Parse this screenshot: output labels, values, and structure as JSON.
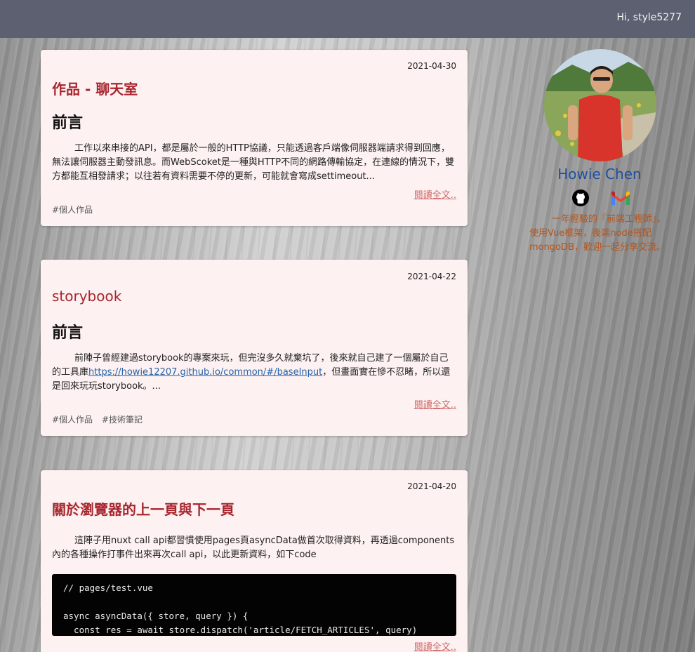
{
  "header": {
    "greeting": "Hi, style5277"
  },
  "posts": [
    {
      "date": "2021-04-30",
      "title": "作品 - 聊天室",
      "heading": "前言",
      "excerpt": "工作以來串接的API，都是屬於一般的HTTP協議，只能透過客戶端像伺服器端請求得到回應，無法讓伺服器主動發訊息。而WebScoket是一種與HTTP不同的網路傳輸協定，在連線的情況下，雙方都能互相發請求；以往若有資料需要不停的更新，可能就會寫成settimeout...",
      "read_more": "閱讀全文..",
      "tags": [
        "#個人作品"
      ]
    },
    {
      "date": "2021-04-22",
      "title": "storybook",
      "heading": "前言",
      "excerpt_before": "前陣子曾經建過storybook的專案來玩，但完沒多久就棄坑了，後來就自己建了一個屬於自己的工具庫",
      "excerpt_link": "https://howie12207.github.io/common/#/baseInput",
      "excerpt_after": "，但畫面實在慘不忍睹，所以還是回來玩玩storybook。...",
      "read_more": "閱讀全文..",
      "tags": [
        "#個人作品",
        "#技術筆記"
      ]
    },
    {
      "date": "2021-04-20",
      "title": "關於瀏覽器的上一頁與下一頁",
      "excerpt": "這陣子用nuxt call api都習慣使用pages頁asyncData做首次取得資料，再透過components內的各種操作打事件出來再次call api，以此更新資料，如下code",
      "code_lines": [
        "// pages/test.vue",
        "",
        "async asyncData({ store, query }) {",
        "  const res = await store.dispatch('article/FETCH_ARTICLES', query)"
      ],
      "read_more": "閱讀全文.."
    }
  ],
  "profile": {
    "name": "Howie Chen",
    "bio": "一年經驗的『前端工程師』，使用Vue框架，後端node搭配mongoDB，歡迎一起分享交流。",
    "icons": [
      "github-icon",
      "gmail-icon"
    ]
  },
  "colors": {
    "topbar": "#5c6070",
    "card": "#fdf1f1",
    "title": "#a8262e",
    "name": "#1d4fa3",
    "bio": "#b5541c",
    "read_more": "#d06a6a"
  }
}
